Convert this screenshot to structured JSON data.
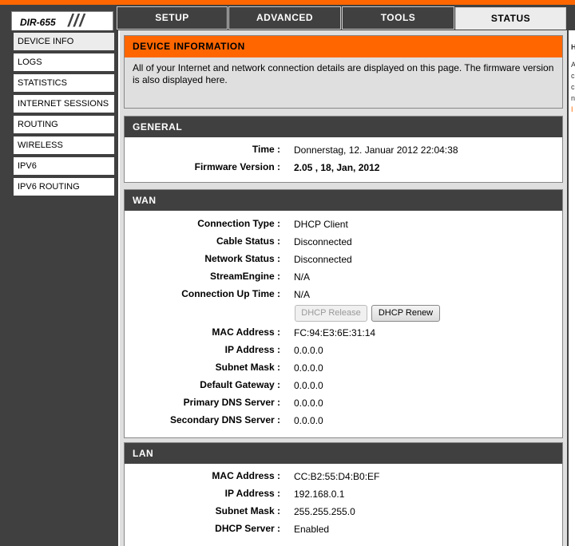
{
  "brand": {
    "logo": "DIR-655"
  },
  "tabs": [
    {
      "label": "SETUP"
    },
    {
      "label": "ADVANCED"
    },
    {
      "label": "TOOLS"
    },
    {
      "label": "STATUS",
      "active": true
    }
  ],
  "sidebar": {
    "items": [
      {
        "label": "DEVICE INFO",
        "active": true
      },
      {
        "label": "LOGS"
      },
      {
        "label": "STATISTICS"
      },
      {
        "label": "INTERNET SESSIONS"
      },
      {
        "label": "ROUTING"
      },
      {
        "label": "WIRELESS"
      },
      {
        "label": "IPV6"
      },
      {
        "label": "IPV6 ROUTING"
      }
    ]
  },
  "intro": {
    "title": "DEVICE INFORMATION",
    "text": "All of your Internet and network connection details are displayed on this page. The firmware version is also displayed here."
  },
  "general": {
    "title": "GENERAL",
    "time_label": "Time :",
    "time_value": "Donnerstag, 12. Januar 2012 22:04:38",
    "firmware_label": "Firmware Version :",
    "firmware_value": "2.05 , 18, Jan, 2012"
  },
  "wan": {
    "title": "WAN",
    "connection_type_label": "Connection Type :",
    "connection_type_value": "DHCP Client",
    "cable_status_label": "Cable Status :",
    "cable_status_value": "Disconnected",
    "network_status_label": "Network Status :",
    "network_status_value": "Disconnected",
    "streamengine_label": "StreamEngine :",
    "streamengine_value": "N/A",
    "uptime_label": "Connection Up Time :",
    "uptime_value": "N/A",
    "release_button": "DHCP Release",
    "renew_button": "DHCP Renew",
    "mac_label": "MAC Address :",
    "mac_value": "FC:94:E3:6E:31:14",
    "ip_label": "IP Address :",
    "ip_value": "0.0.0.0",
    "subnet_label": "Subnet Mask :",
    "subnet_value": "0.0.0.0",
    "gateway_label": "Default Gateway :",
    "gateway_value": "0.0.0.0",
    "dns1_label": "Primary DNS Server :",
    "dns1_value": "0.0.0.0",
    "dns2_label": "Secondary DNS Server :",
    "dns2_value": "0.0.0.0"
  },
  "lan": {
    "title": "LAN",
    "mac_label": "MAC Address :",
    "mac_value": "CC:B2:55:D4:B0:EF",
    "ip_label": "IP Address :",
    "ip_value": "192.168.0.1",
    "subnet_label": "Subnet Mask :",
    "subnet_value": "255.255.255.0",
    "dhcp_label": "DHCP Server :",
    "dhcp_value": "Enabled"
  },
  "right_panel": {
    "marks": [
      "H",
      "A",
      "c",
      "c",
      "n",
      "I"
    ]
  },
  "colors": {
    "accent": "#ff6600",
    "dark": "#404040",
    "panel": "#dfdfdf"
  }
}
